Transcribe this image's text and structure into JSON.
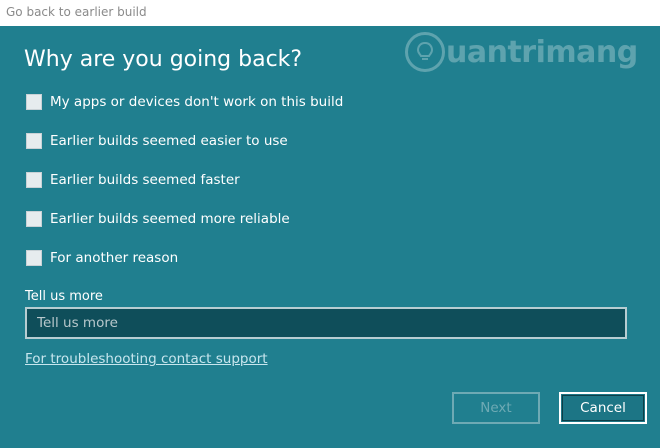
{
  "window": {
    "title": "Go back to earlier build"
  },
  "heading": "Why are you going back?",
  "watermark": {
    "text": "uantrimang",
    "icon": "lightbulb-icon"
  },
  "options": [
    {
      "label": "My apps or devices don't work on this build",
      "checked": false
    },
    {
      "label": "Earlier builds seemed easier to use",
      "checked": false
    },
    {
      "label": "Earlier builds seemed faster",
      "checked": false
    },
    {
      "label": "Earlier builds seemed more reliable",
      "checked": false
    },
    {
      "label": "For another reason",
      "checked": false
    }
  ],
  "feedback": {
    "label": "Tell us more",
    "placeholder": "Tell us more",
    "value": ""
  },
  "support_link": "For troubleshooting contact support",
  "buttons": {
    "next": "Next",
    "cancel": "Cancel"
  },
  "colors": {
    "background": "#207f8f",
    "input_background": "#0f4e5a",
    "link": "#c8e6ee"
  }
}
